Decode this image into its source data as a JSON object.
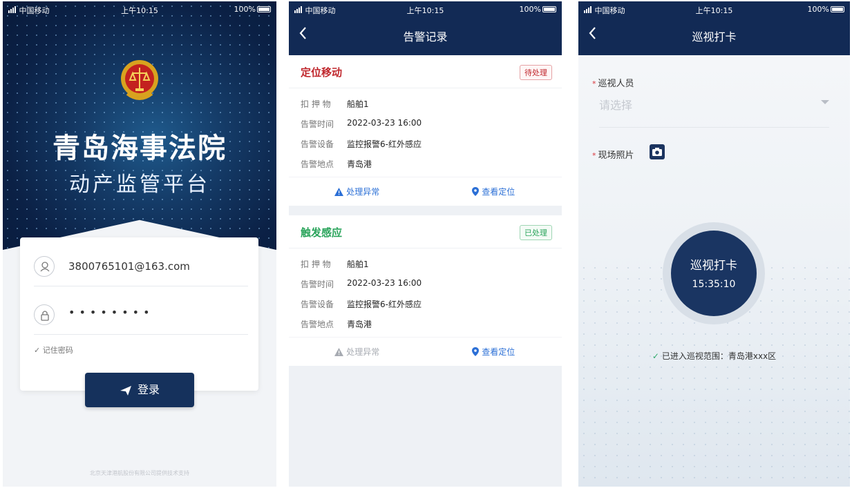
{
  "status_bar": {
    "carrier": "中国移动",
    "time": "上午10:15",
    "battery": "100%"
  },
  "login": {
    "title": "青岛海事法院",
    "subtitle": "动产监管平台",
    "username": "3800765101@163.com",
    "password_mask": "••••••••",
    "remember": "记住密码",
    "login_button": "登录",
    "footer": "北京天津港航股份有限公司提供技术支持"
  },
  "alarms": {
    "title": "告警记录",
    "items": [
      {
        "type": "定位移动",
        "status": "待处理",
        "type_color": "#c0272d",
        "status_color": "#c0272d",
        "fields": [
          {
            "k": "扣 押 物",
            "v": "船舶1"
          },
          {
            "k": "告警时间",
            "v": "2022-03-23 16:00"
          },
          {
            "k": "告警设备",
            "v": "监控报警6-红外感应"
          },
          {
            "k": "告警地点",
            "v": "青岛港"
          }
        ],
        "action_handle": "处理异常",
        "action_locate": "查看定位"
      },
      {
        "type": "触发感应",
        "status": "已处理",
        "type_color": "#2aa45b",
        "status_color": "#2aa45b",
        "fields": [
          {
            "k": "扣 押 物",
            "v": "船舶1"
          },
          {
            "k": "告警时间",
            "v": "2022-03-23 16:00"
          },
          {
            "k": "告警设备",
            "v": "监控报警6-红外感应"
          },
          {
            "k": "告警地点",
            "v": "青岛港"
          }
        ],
        "action_handle": "处理异常",
        "action_locate": "查看定位"
      }
    ]
  },
  "patrol": {
    "title": "巡视打卡",
    "inspector_label": "巡视人员",
    "inspector_placeholder": "请选择",
    "photo_label": "现场照片",
    "punch_label": "巡视打卡",
    "punch_time": "15:35:10",
    "range_text": "已进入巡视范围：青岛港xxx区"
  }
}
